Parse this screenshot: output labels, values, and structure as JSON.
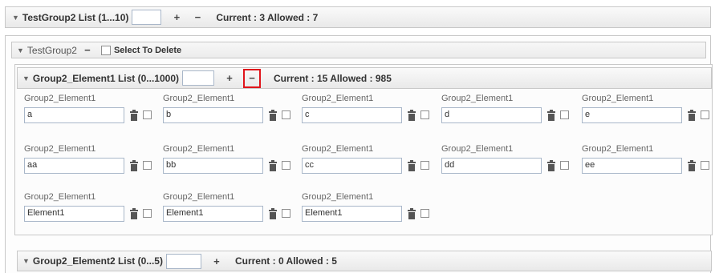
{
  "outer_list": {
    "title": "TestGroup2 List (1...10)",
    "add_symbol": "+",
    "remove_symbol": "−",
    "status": "Current : 3 Allowed : 7"
  },
  "group_header": {
    "title": "TestGroup2",
    "remove_symbol": "−",
    "select_to_delete": "Select To Delete"
  },
  "element1_list": {
    "title": "Group2_Element1 List (0...1000)",
    "add_symbol": "+",
    "remove_symbol": "−",
    "status": "Current : 15 Allowed : 985",
    "rows": [
      [
        {
          "label": "Group2_Element1",
          "value": "a"
        },
        {
          "label": "Group2_Element1",
          "value": "b"
        },
        {
          "label": "Group2_Element1",
          "value": "c"
        },
        {
          "label": "Group2_Element1",
          "value": "d"
        },
        {
          "label": "Group2_Element1",
          "value": "e"
        }
      ],
      [
        {
          "label": "Group2_Element1",
          "value": "aa"
        },
        {
          "label": "Group2_Element1",
          "value": "bb"
        },
        {
          "label": "Group2_Element1",
          "value": "cc"
        },
        {
          "label": "Group2_Element1",
          "value": "dd"
        },
        {
          "label": "Group2_Element1",
          "value": "ee"
        }
      ],
      [
        {
          "label": "Group2_Element1",
          "value": "Element1"
        },
        {
          "label": "Group2_Element1",
          "value": "Element1"
        },
        {
          "label": "Group2_Element1",
          "value": "Element1"
        }
      ]
    ]
  },
  "element2_list": {
    "title": "Group2_Element2 List (0...5)",
    "add_symbol": "+",
    "status": "Current : 0 Allowed : 5"
  },
  "colors": {
    "highlight": "#e0141b",
    "border": "#c8c8c8",
    "input_border": "#a9b7c9"
  },
  "icons": [
    "chevron-down-icon",
    "plus-icon",
    "minus-icon",
    "trash-icon",
    "checkbox"
  ]
}
